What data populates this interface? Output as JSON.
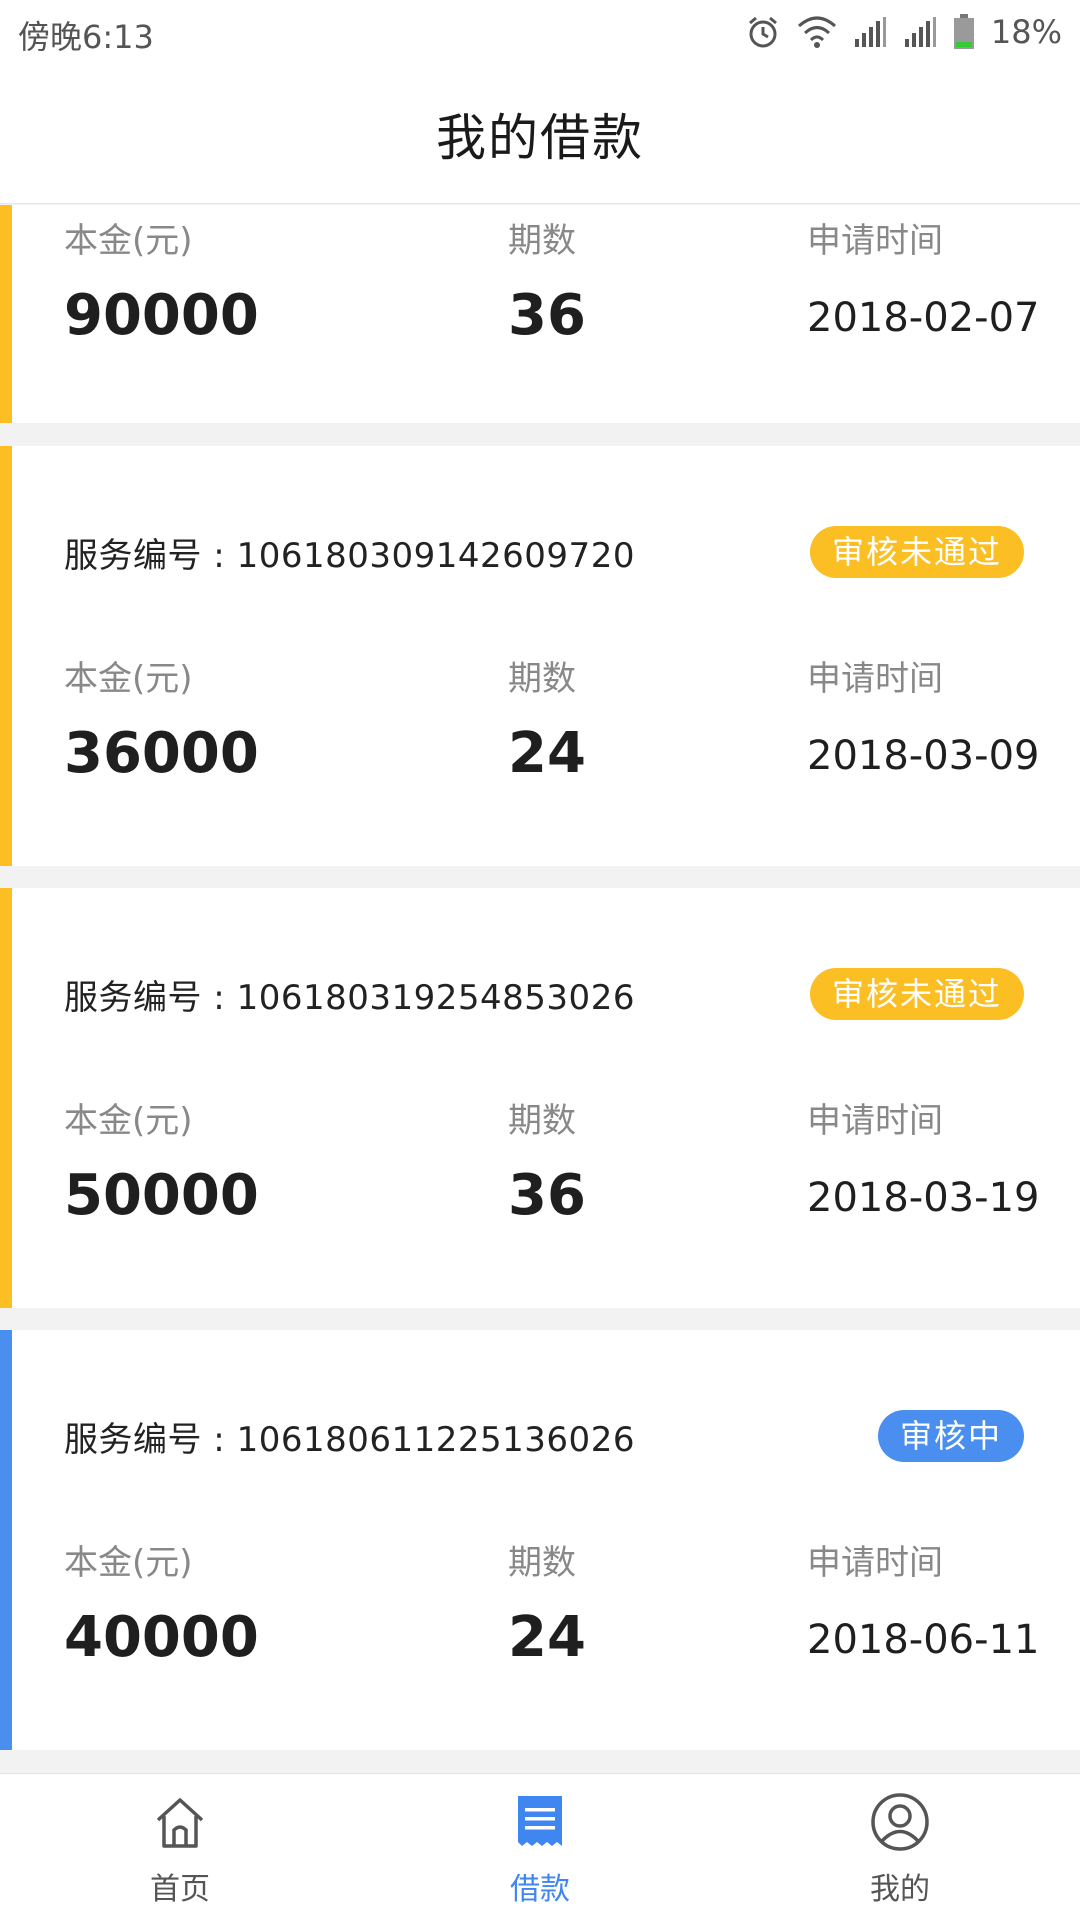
{
  "status_bar": {
    "time": "傍晚6:13",
    "battery_percent": "18%",
    "icons": [
      "alarm-icon",
      "wifi-icon",
      "signal-icon",
      "signal-icon",
      "battery-icon"
    ]
  },
  "header": {
    "title": "我的借款"
  },
  "colors": {
    "rejected": "#fbbf24",
    "reviewing": "#4a8ff0",
    "nav_active": "#3f86f0"
  },
  "loans": [
    {
      "service_prefix": "",
      "service_number": "",
      "status": "",
      "principal_label": "本金(元)",
      "principal": "90000",
      "periods_label": "期数",
      "periods": "36",
      "date_label": "申请时间",
      "date": "2018-02-07"
    },
    {
      "service_prefix": "服务编号 : ",
      "service_number": "106180309142609720",
      "status": "审核未通过",
      "principal_label": "本金(元)",
      "principal": "36000",
      "periods_label": "期数",
      "periods": "24",
      "date_label": "申请时间",
      "date": "2018-03-09"
    },
    {
      "service_prefix": "服务编号 : ",
      "service_number": "106180319254853026",
      "status": "审核未通过",
      "principal_label": "本金(元)",
      "principal": "50000",
      "periods_label": "期数",
      "periods": "36",
      "date_label": "申请时间",
      "date": "2018-03-19"
    },
    {
      "service_prefix": "服务编号 : ",
      "service_number": "106180611225136026",
      "status": "审核中",
      "principal_label": "本金(元)",
      "principal": "40000",
      "periods_label": "期数",
      "periods": "24",
      "date_label": "申请时间",
      "date": "2018-06-11"
    }
  ],
  "bottom_nav": [
    {
      "label": "首页",
      "icon": "home-icon",
      "active": false
    },
    {
      "label": "借款",
      "icon": "document-icon",
      "active": true
    },
    {
      "label": "我的",
      "icon": "user-icon",
      "active": false
    }
  ]
}
